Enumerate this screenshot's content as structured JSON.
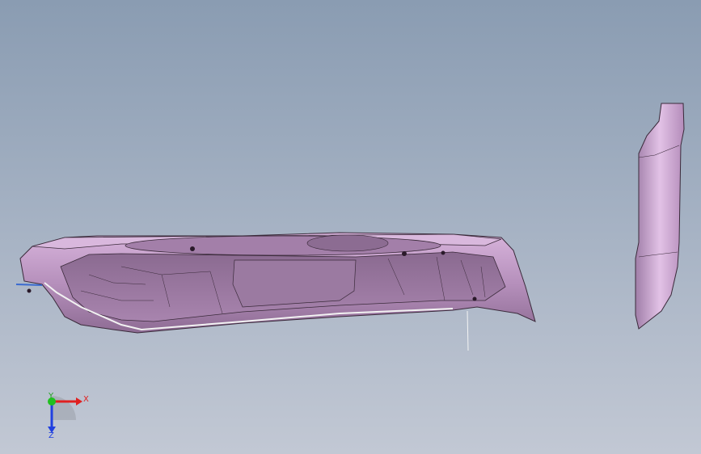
{
  "viewport": {
    "background_top": "#8a9cb2",
    "background_bottom": "#c2c8d4"
  },
  "model": {
    "part_color": "#c8a0cc",
    "part_shadow": "#9a7aa0",
    "edge_color": "#3a2a3a"
  },
  "triad": {
    "x_label": "X",
    "y_label": "Y",
    "z_label": "Z",
    "x_color": "#e02020",
    "y_color": "#20c020",
    "z_color": "#2040e0"
  }
}
